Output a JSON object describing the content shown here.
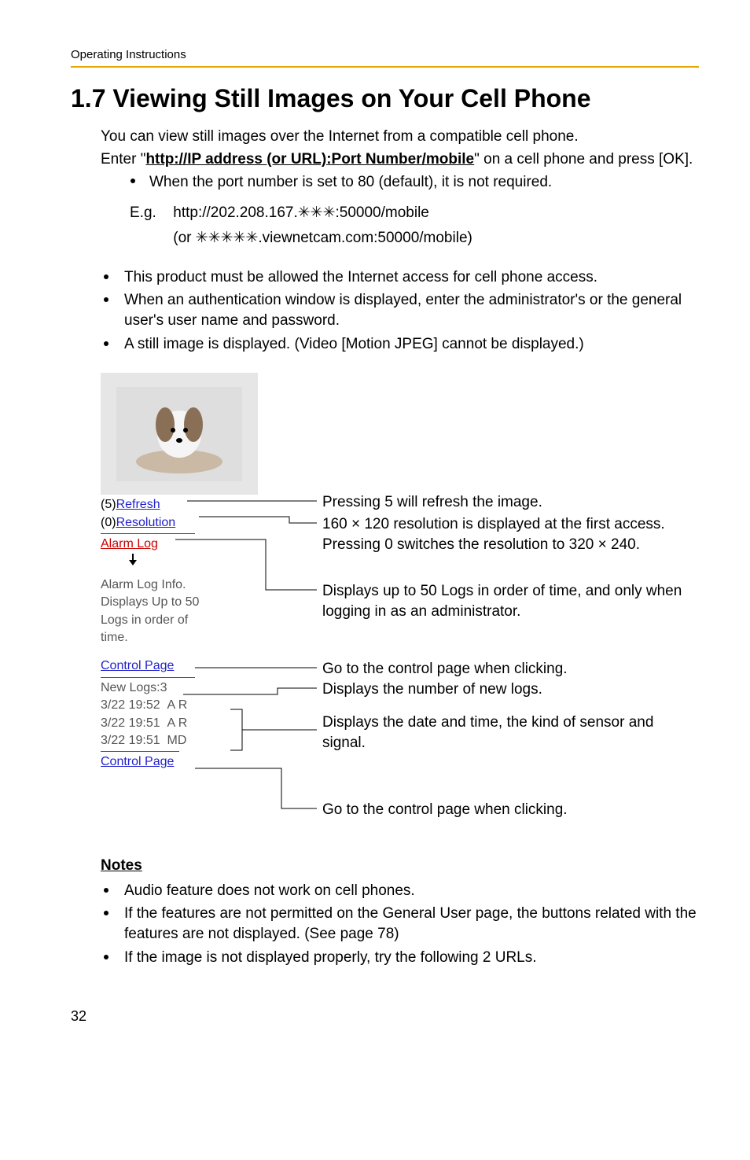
{
  "runningHeader": "Operating Instructions",
  "heading": "1.7   Viewing Still Images on Your Cell Phone",
  "intro": {
    "line1": "You can view still images over the Internet from a compatible cell phone.",
    "line2_pre": "Enter \"",
    "line2_url": "http://IP address (or URL):Port Number/mobile",
    "line2_post": "\" on a cell phone and press [OK].",
    "subBullet": "When the port number is set to 80 (default), it is not required."
  },
  "eg": {
    "label": "E.g.",
    "line1": "http://202.208.167.✳✳✳:50000/mobile",
    "line2": "(or ✳✳✳✳✳.viewnetcam.com:50000/mobile)"
  },
  "mainBullets": [
    "This product must be allowed the Internet access for cell phone access.",
    "When an authentication window is displayed, enter the administrator's or the general user's user name and password.",
    "A still image is displayed. (Video [Motion JPEG] cannot be displayed.)"
  ],
  "phone": {
    "refresh_pre": "(5)",
    "refresh": "Refresh",
    "resolution_pre": "(0)",
    "resolution": "Resolution",
    "alarmLog": "Alarm Log",
    "alarmInfo1": "Alarm Log Info.",
    "alarmInfo2": "Displays Up to 50",
    "alarmInfo3": "Logs in order of",
    "alarmInfo4": "time.",
    "controlPage": "Control Page",
    "newLogs": "New Logs:3",
    "row1_time": "3/22 19:52",
    "row1_kind": "A R",
    "row2_time": "3/22 19:51",
    "row2_kind": "A R",
    "row3_time": "3/22 19:51",
    "row3_kind": "MD"
  },
  "callouts": {
    "c1": "Pressing 5 will refresh the image.",
    "c2": "160 × 120 resolution is displayed at the first access. Pressing 0 switches the resolution to 320 × 240.",
    "c3": "Displays up to 50 Logs in order of time, and only when logging in as an administrator.",
    "c4": "Go to the control page when clicking.",
    "c5": "Displays the number of new logs.",
    "c6": "Displays the date and time, the kind of sensor and signal.",
    "c7": "Go to the control page when clicking."
  },
  "notes": {
    "heading": "Notes",
    "items": [
      "Audio feature does not work on cell phones.",
      "If the features are not permitted on the General User page, the buttons related with the features are not displayed. (See page 78)",
      "If the image is not displayed properly, try the following 2 URLs."
    ]
  },
  "pageNumber": "32"
}
